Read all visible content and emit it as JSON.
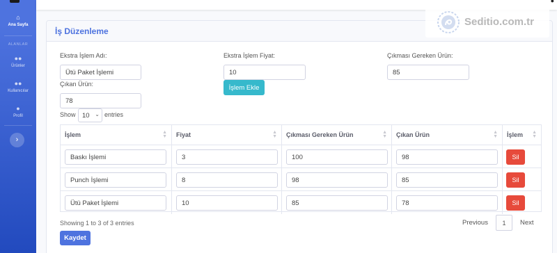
{
  "sidebar": {
    "home": {
      "label": "Ana Sayfa",
      "icon": "home-icon"
    },
    "section_heading": "ALANLAR",
    "items": [
      {
        "label": "Ürünler",
        "icon": "users-icon"
      },
      {
        "label": "Kullanıcılar",
        "icon": "users-icon"
      },
      {
        "label": "Profil",
        "icon": "user-icon"
      }
    ],
    "toggle_icon": "chevron-right-icon"
  },
  "card": {
    "title": "İş Düzenleme"
  },
  "form": {
    "ad_label": "Ekstra İşlem Adı:",
    "ad_value": "Ütü Paket İşlemi",
    "fiyat_label": "Ekstra İşlem Fiyat:",
    "fiyat_value": "10",
    "cikmasi_label": "Çıkması Gereken Ürün:",
    "cikmasi_value": "85",
    "cikan_label": "Çıkan Ürün:",
    "cikan_value": "78",
    "add_button": "İşlem Ekle"
  },
  "table": {
    "show_label": "Show",
    "show_value": "10",
    "entries_label": "entries",
    "headers": [
      "İşlem",
      "Fiyat",
      "Çıkması Gereken Ürün",
      "Çıkan Ürün",
      "İşlem"
    ],
    "rows": [
      {
        "islem": "Baskı İşlemi",
        "fiyat": "3",
        "cikmasi": "100",
        "cikan": "98",
        "action": "Sil"
      },
      {
        "islem": "Punch İşlemi",
        "fiyat": "8",
        "cikmasi": "98",
        "cikan": "85",
        "action": "Sil"
      },
      {
        "islem": "Ütü Paket İşlemi",
        "fiyat": "10",
        "cikmasi": "85",
        "cikan": "78",
        "action": "Sil"
      }
    ],
    "info": "Showing 1 to 3 of 3 entries",
    "previous": "Previous",
    "page": "1",
    "next": "Next"
  },
  "save_button": "Kaydet",
  "watermark": {
    "text": "Seditio.com.tr"
  },
  "colors": {
    "primary": "#4e73df",
    "info": "#36b9cc",
    "danger": "#e74a3b"
  }
}
